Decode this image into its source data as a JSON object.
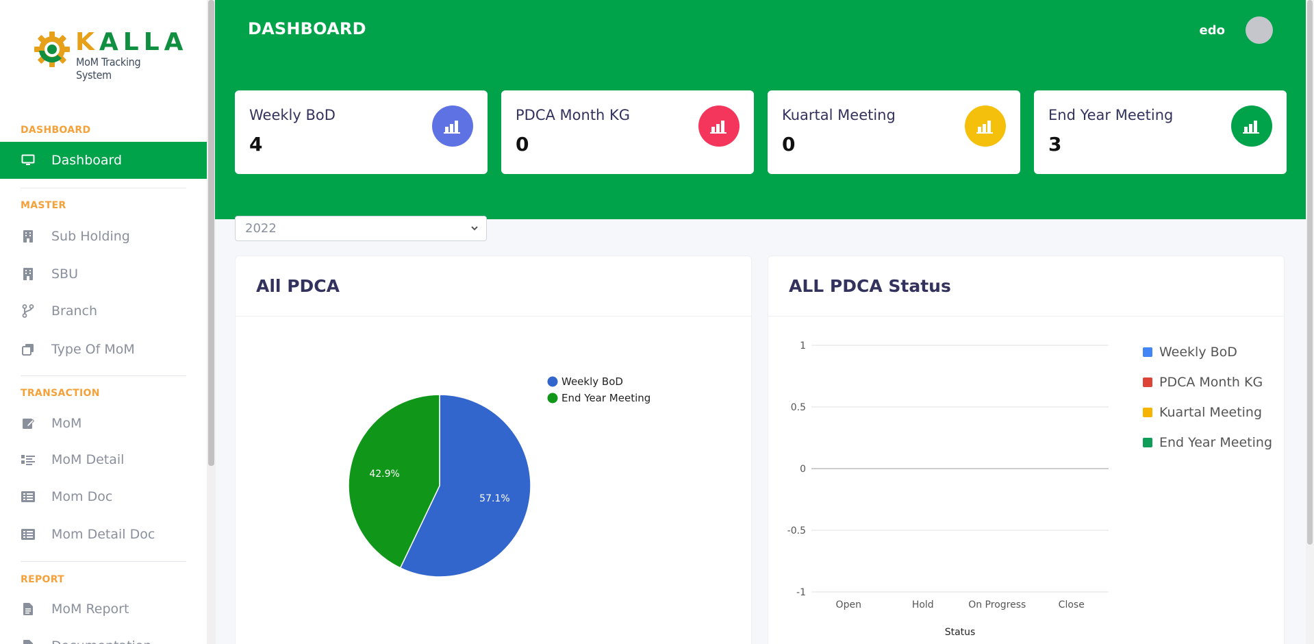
{
  "brand": {
    "word": "KALLA",
    "subtitle": "MoM Tracking System"
  },
  "sidebar": {
    "sections": [
      {
        "title": "DASHBOARD",
        "items": [
          {
            "label": "Dashboard",
            "icon": "monitor-icon",
            "active": true
          }
        ]
      },
      {
        "title": "MASTER",
        "items": [
          {
            "label": "Sub Holding",
            "icon": "building-icon"
          },
          {
            "label": "SBU",
            "icon": "building-icon"
          },
          {
            "label": "Branch",
            "icon": "branch-icon"
          },
          {
            "label": "Type Of MoM",
            "icon": "copy-icon"
          }
        ]
      },
      {
        "title": "TRANSACTION",
        "items": [
          {
            "label": "MoM",
            "icon": "edit-icon"
          },
          {
            "label": "MoM Detail",
            "icon": "list-details-icon"
          },
          {
            "label": "Mom Doc",
            "icon": "list-icon"
          },
          {
            "label": "Mom Detail Doc",
            "icon": "list-icon"
          }
        ]
      },
      {
        "title": "REPORT",
        "items": [
          {
            "label": "MoM Report",
            "icon": "file-icon"
          },
          {
            "label": "Documentation",
            "icon": "file-icon"
          }
        ]
      }
    ]
  },
  "header": {
    "title": "DASHBOARD",
    "user": "edo"
  },
  "stats": [
    {
      "title": "Weekly BoD",
      "value": "4",
      "color": "#5e72e4"
    },
    {
      "title": "PDCA Month KG",
      "value": "0",
      "color": "#f5365c"
    },
    {
      "title": "Kuartal Meeting",
      "value": "0",
      "color": "#f4c00b"
    },
    {
      "title": "End Year Meeting",
      "value": "3",
      "color": "#00a24a"
    }
  ],
  "filter": {
    "year": "2022"
  },
  "panels": {
    "left_title": "All PDCA",
    "right_title": "ALL PDCA Status"
  },
  "chart_data": [
    {
      "type": "pie",
      "title": "All PDCA",
      "slices": [
        {
          "name": "Weekly BoD",
          "value": 57.1,
          "label": "57.1%",
          "color": "#3366cc"
        },
        {
          "name": "End Year Meeting",
          "value": 42.9,
          "label": "42.9%",
          "color": "#109618"
        }
      ],
      "legend": "right"
    },
    {
      "type": "bar",
      "title": "ALL PDCA Status",
      "categories": [
        "Open",
        "Hold",
        "On Progress",
        "Close"
      ],
      "xlabel": "Status",
      "ylim": [
        -1,
        1
      ],
      "yticks": [
        1,
        0.5,
        0,
        -0.5,
        -1
      ],
      "yticklabels": [
        "1",
        "0.5",
        "0",
        "-0.5",
        "-1"
      ],
      "series": [
        {
          "name": "Weekly BoD",
          "values": [
            0,
            0,
            0,
            0
          ],
          "color": "#4285f4"
        },
        {
          "name": "PDCA Month KG",
          "values": [
            0,
            0,
            0,
            0
          ],
          "color": "#db4437"
        },
        {
          "name": "Kuartal Meeting",
          "values": [
            0,
            0,
            0,
            0
          ],
          "color": "#f4b400"
        },
        {
          "name": "End Year Meeting",
          "values": [
            0,
            0,
            0,
            0
          ],
          "color": "#0f9d58"
        }
      ],
      "legend": "right",
      "grid": true
    }
  ]
}
